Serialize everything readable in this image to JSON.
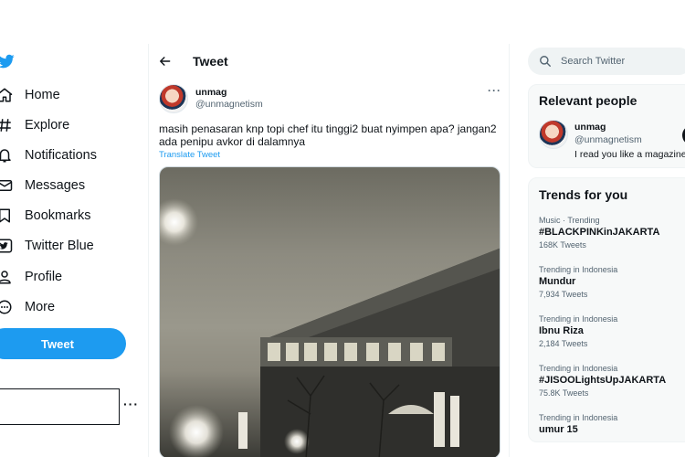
{
  "nav": {
    "items": [
      {
        "label": "Home",
        "icon": "home-icon"
      },
      {
        "label": "Explore",
        "icon": "hashtag-icon"
      },
      {
        "label": "Notifications",
        "icon": "bell-icon"
      },
      {
        "label": "Messages",
        "icon": "envelope-icon"
      },
      {
        "label": "Bookmarks",
        "icon": "bookmark-icon"
      },
      {
        "label": "Twitter Blue",
        "icon": "twitter-blue-icon"
      },
      {
        "label": "Profile",
        "icon": "person-icon"
      },
      {
        "label": "More",
        "icon": "more-circle-icon"
      }
    ],
    "tweet_button": "Tweet",
    "account_more": "···"
  },
  "main": {
    "title": "Tweet",
    "tweet": {
      "author_name": "unmag",
      "author_handle": "@unmagnetism",
      "more": "···",
      "text": "masih penasaran knp topi chef itu tinggi2 buat nyimpen apa? jangan2 ada penipu avkor di dalamnya",
      "translate": "Translate Tweet"
    }
  },
  "search": {
    "placeholder": "Search Twitter"
  },
  "relevant_people": {
    "title": "Relevant people",
    "person": {
      "name": "unmag",
      "handle": "@unmagnetism",
      "bio": "I read you like a magazine w"
    }
  },
  "trends": {
    "title": "Trends for you",
    "items": [
      {
        "context": "Music · Trending",
        "name": "#BLACKPINKinJAKARTA",
        "count": "168K Tweets"
      },
      {
        "context": "Trending in Indonesia",
        "name": "Mundur",
        "count": "7,934 Tweets"
      },
      {
        "context": "Trending in Indonesia",
        "name": "Ibnu Riza",
        "count": "2,184 Tweets"
      },
      {
        "context": "Trending in Indonesia",
        "name": "#JISOOLightsUpJAKARTA",
        "count": "75.8K Tweets"
      },
      {
        "context": "Trending in Indonesia",
        "name": "umur 15",
        "count": ""
      }
    ]
  },
  "colors": {
    "accent": "#1d9bf0",
    "text": "#0f1419",
    "secondary": "#536471",
    "panel": "#f7f9f9"
  }
}
